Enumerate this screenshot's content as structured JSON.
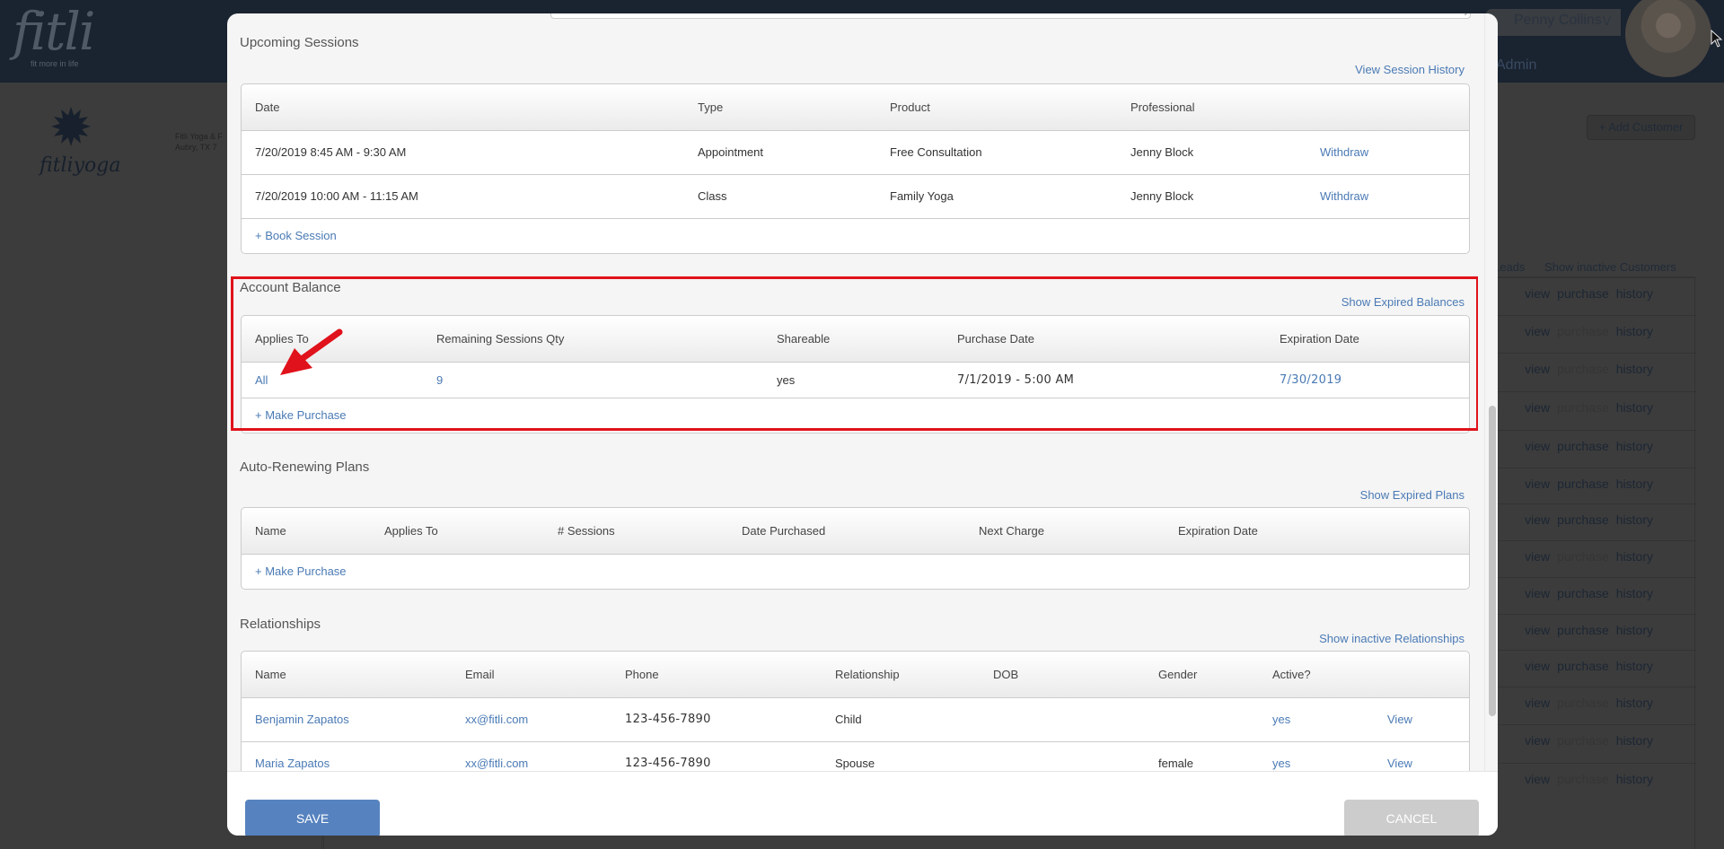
{
  "background": {
    "brand": {
      "name": "fitli",
      "tagline": "fit more in life"
    },
    "user": {
      "name": "Penny Collins",
      "chevron_icon": "double-chevron-down",
      "role": "Admin"
    },
    "org": {
      "logo_text": "fitliyoga",
      "address_line1": "Fitli Yoga & F",
      "address_line2": "Aubry, TX 7"
    },
    "add_customer_label": "+ Add Customer",
    "filter_links": [
      "w Leads",
      "Show inactive Customers"
    ],
    "row_actions": {
      "view": "view",
      "purchase": "purchase",
      "history": "history"
    },
    "rows_purchase_enabled": [
      true,
      false,
      false,
      false,
      true,
      true,
      true,
      false,
      true,
      true,
      true,
      false,
      false,
      false
    ]
  },
  "modal": {
    "upcoming_sessions": {
      "title": "Upcoming Sessions",
      "history_link": "View Session History",
      "columns": [
        "Date",
        "Type",
        "Product",
        "Professional"
      ],
      "rows": [
        {
          "date": "7/20/2019 8:45 AM - 9:30 AM",
          "type": "Appointment",
          "product": "Free Consultation",
          "professional": "Jenny Block",
          "action": "Withdraw"
        },
        {
          "date": "7/20/2019 10:00 AM - 11:15 AM",
          "type": "Class",
          "product": "Family Yoga",
          "professional": "Jenny Block",
          "action": "Withdraw"
        }
      ],
      "add_label": "+ Book Session"
    },
    "account_balance": {
      "title": "Account Balance",
      "expired_link": "Show Expired Balances",
      "columns": [
        "Applies To",
        "Remaining Sessions Qty",
        "Shareable",
        "Purchase Date",
        "Expiration Date"
      ],
      "rows": [
        {
          "applies_to": "All",
          "remaining": "9",
          "shareable": "yes",
          "purchase_date": "7/1/2019 - 5:00 AM",
          "expiration_date": "7/30/2019"
        }
      ],
      "add_label": "+ Make Purchase",
      "highlight_color": "#e0121b"
    },
    "auto_renewing": {
      "title": "Auto-Renewing Plans",
      "expired_link": "Show Expired Plans",
      "columns": [
        "Name",
        "Applies To",
        "# Sessions",
        "Date Purchased",
        "Next Charge",
        "Expiration Date"
      ],
      "add_label": "+ Make Purchase"
    },
    "relationships": {
      "title": "Relationships",
      "inactive_link": "Show inactive Relationships",
      "columns": [
        "Name",
        "Email",
        "Phone",
        "Relationship",
        "DOB",
        "Gender",
        "Active?"
      ],
      "rows": [
        {
          "name": "Benjamin Zapatos",
          "email": "xx@fitli.com",
          "phone": "123-456-7890",
          "relationship": "Child",
          "dob": "",
          "gender": "",
          "active": "yes",
          "action": "View"
        },
        {
          "name": "Maria Zapatos",
          "email": "xx@fitli.com",
          "phone": "123-456-7890",
          "relationship": "Spouse",
          "dob": "",
          "gender": "female",
          "active": "yes",
          "action": "View"
        }
      ]
    },
    "footer": {
      "save_label": "SAVE",
      "cancel_label": "CANCEL"
    }
  },
  "colors": {
    "link": "#4a7ab5",
    "save": "#5682bf",
    "cancel": "#cccccc",
    "topbar": "#1a2330"
  }
}
